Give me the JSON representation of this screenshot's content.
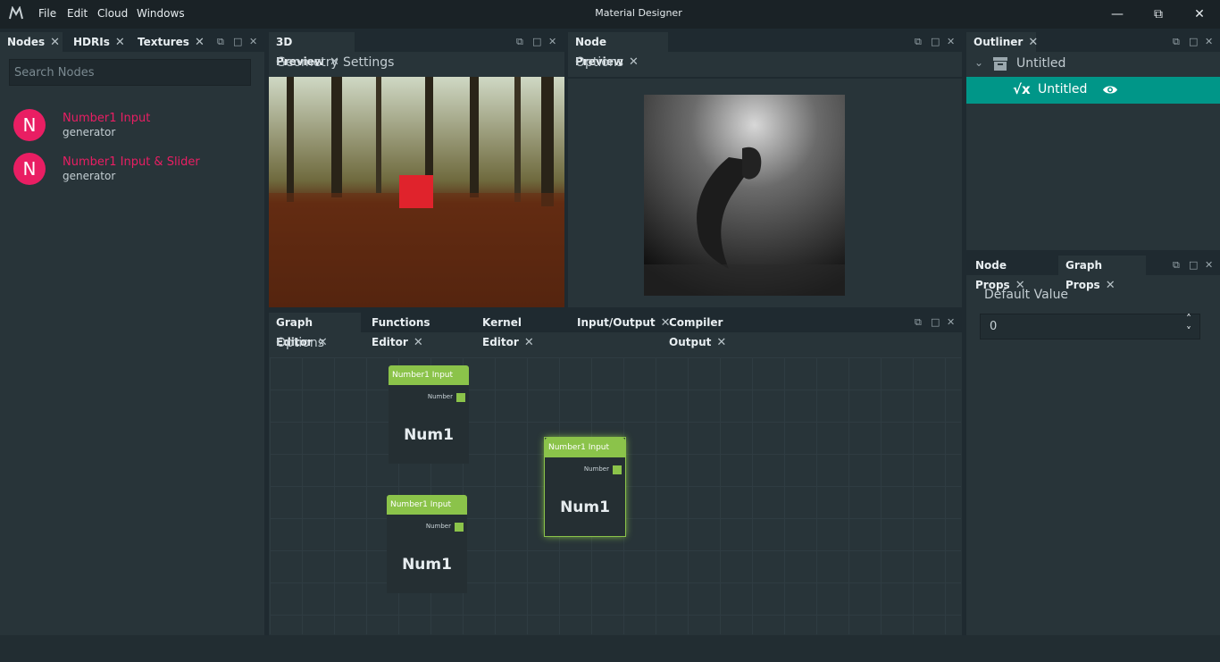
{
  "app": {
    "title": "Material Designer",
    "menu": [
      "File",
      "Edit",
      "Cloud",
      "Windows"
    ]
  },
  "nodes_panel": {
    "tabs": [
      "Nodes",
      "HDRIs",
      "Textures"
    ],
    "search_placeholder": "Search Nodes",
    "items": [
      {
        "letter": "N",
        "name": "Number1 Input",
        "type": "generator"
      },
      {
        "letter": "N",
        "name": "Number1 Input & Slider",
        "type": "generator"
      }
    ]
  },
  "preview3d": {
    "tab": "3D Preview",
    "menu": [
      "Geometry",
      "Settings"
    ]
  },
  "node_preview": {
    "tab": "Node Preview",
    "menu": "Options"
  },
  "outliner": {
    "tab": "Outliner",
    "root": "Untitled",
    "child": "Untitled"
  },
  "props": {
    "tabs": [
      "Node Props",
      "Graph Props"
    ],
    "field_label": "Default Value",
    "field_value": "0"
  },
  "graph_editor": {
    "tabs": [
      "Graph Editor",
      "Functions Editor",
      "Kernel Editor",
      "Input/Output",
      "Compiler Output"
    ],
    "menu": "Options",
    "nodes": [
      {
        "title": "Number1 Input",
        "port": "Number",
        "value": "Num1",
        "selected": false
      },
      {
        "title": "Number1 Input",
        "port": "Number",
        "value": "Num1",
        "selected": false
      },
      {
        "title": "Number1 Input",
        "port": "Number",
        "value": "Num1",
        "selected": true
      }
    ]
  },
  "colors": {
    "accent": "#e91e63",
    "node_header": "#8bc34a",
    "outliner_selected": "#009688"
  }
}
